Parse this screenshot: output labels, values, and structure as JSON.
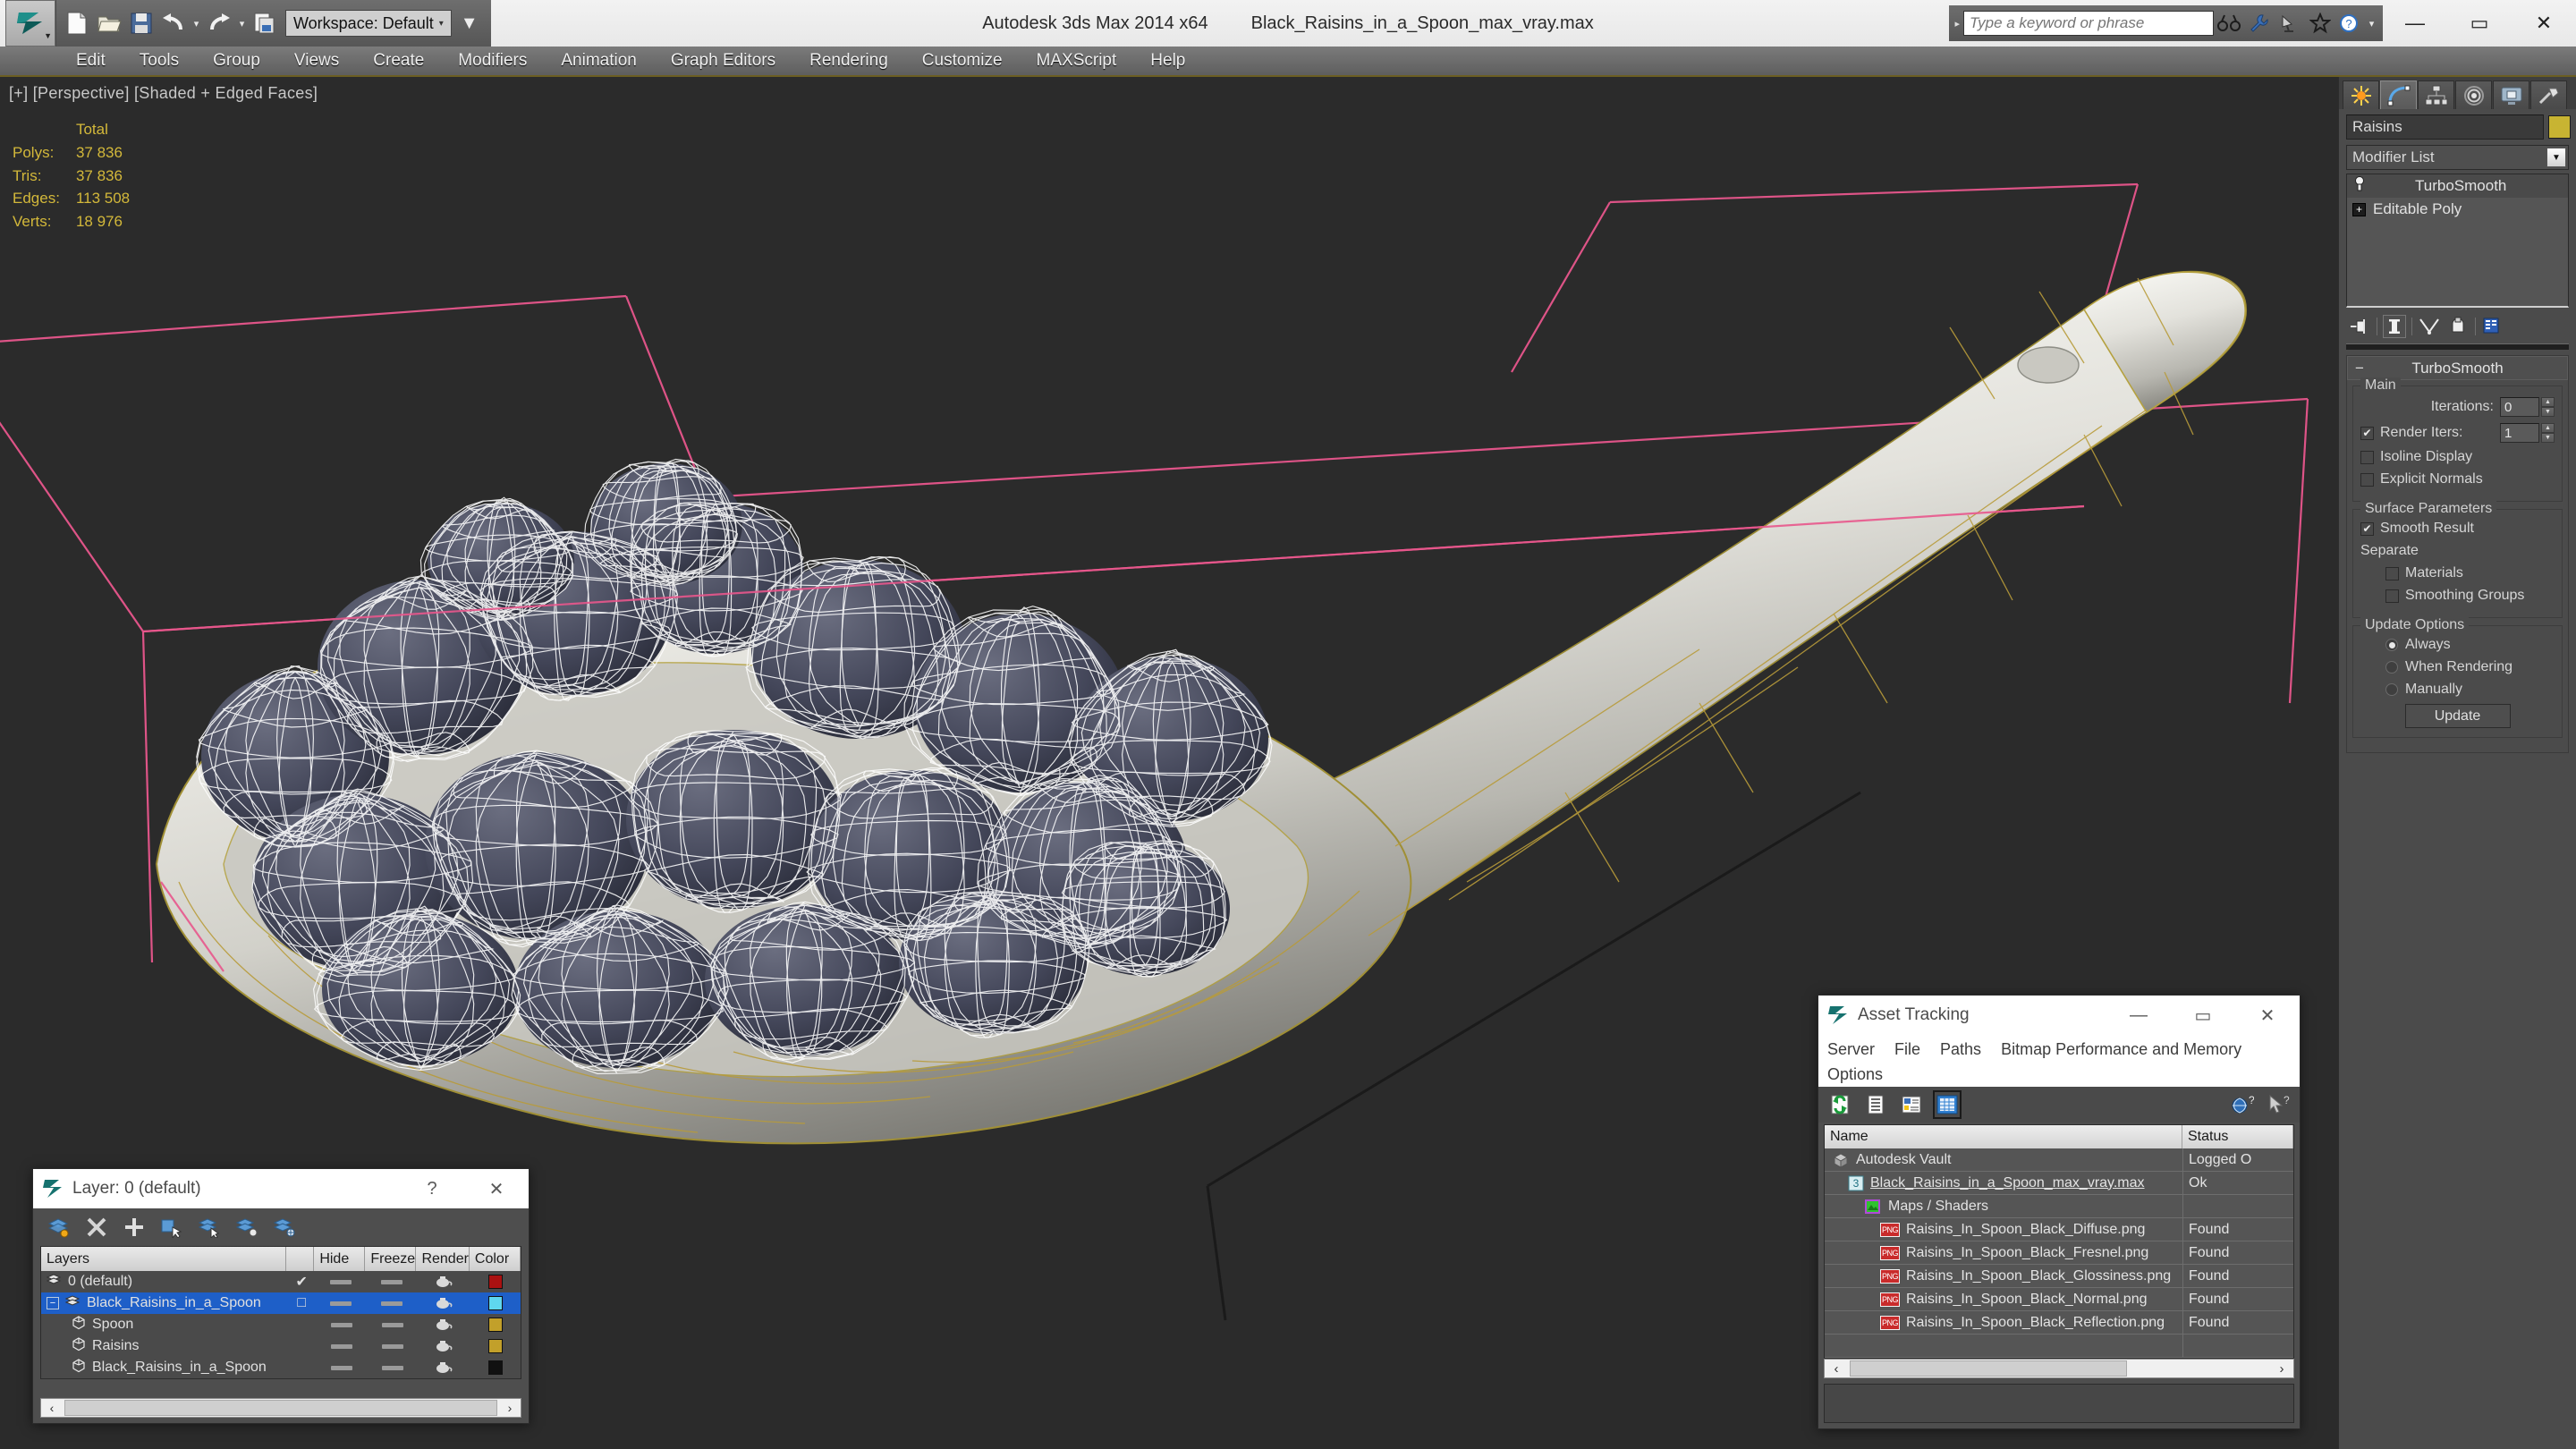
{
  "app": {
    "title": "Autodesk 3ds Max  2014 x64",
    "document": "Black_Raisins_in_a_Spoon_max_vray.max",
    "workspace_label": "Workspace: Default"
  },
  "quick_access": {
    "buttons": [
      "new-file-icon",
      "open-file-icon",
      "save-file-icon",
      "undo-icon",
      "redo-icon",
      "project-folder-icon"
    ]
  },
  "search": {
    "placeholder": "Type a keyword or phrase",
    "icons": [
      "binoculars-icon",
      "wrench-icon",
      "satellite-dish-icon",
      "star-icon",
      "help-icon"
    ]
  },
  "window_controls": {
    "minimize": "—",
    "maximize": "▭",
    "close": "✕"
  },
  "menubar": {
    "items": [
      "Edit",
      "Tools",
      "Group",
      "Views",
      "Create",
      "Modifiers",
      "Animation",
      "Graph Editors",
      "Rendering",
      "Customize",
      "MAXScript",
      "Help"
    ]
  },
  "viewport": {
    "label": "[+] [Perspective] [Shaded + Edged Faces]",
    "stats": {
      "header": "Total",
      "rows": [
        {
          "label": "Polys:",
          "value": "37 836"
        },
        {
          "label": "Tris:",
          "value": "37 836"
        },
        {
          "label": "Edges:",
          "value": "113 508"
        },
        {
          "label": "Verts:",
          "value": "18 976"
        }
      ]
    },
    "colors": {
      "background": "#2b2b2b",
      "wireframe": "#ffffff",
      "gizmo_pink": "#e8568c",
      "spoon_wire": "#b89b3a",
      "raisin_body": "#4a4d5c"
    }
  },
  "command_panel": {
    "tabs": [
      "create-tab-icon",
      "modify-tab-icon",
      "hierarchy-tab-icon",
      "motion-tab-icon",
      "display-tab-icon",
      "utilities-tab-icon"
    ],
    "active_tab_index": 1,
    "object_name": "Raisins",
    "object_color": "#c8b432",
    "modifier_list_label": "Modifier List",
    "modifier_stack": [
      {
        "label": "TurboSmooth",
        "selected": true
      },
      {
        "label": "Editable Poly",
        "selected": false
      }
    ],
    "stack_tools": [
      "pin-stack-icon",
      "show-end-result-icon",
      "make-unique-icon",
      "remove-modifier-icon",
      "configure-modifier-sets-icon"
    ],
    "rollout": {
      "title": "TurboSmooth",
      "groups": [
        {
          "label": "Main",
          "fields": [
            {
              "type": "spinner",
              "label": "Iterations:",
              "value": "0"
            },
            {
              "type": "check-spinner",
              "label": "Render Iters:",
              "value": "1",
              "checked": true
            },
            {
              "type": "checkbox",
              "label": "Isoline Display",
              "checked": false
            },
            {
              "type": "checkbox",
              "label": "Explicit Normals",
              "checked": false
            }
          ]
        },
        {
          "label": "Surface Parameters",
          "fields": [
            {
              "type": "checkbox",
              "label": "Smooth Result",
              "checked": true
            },
            {
              "type": "text",
              "label": "Separate"
            },
            {
              "type": "checkbox",
              "label": "Materials",
              "checked": false,
              "indent": true
            },
            {
              "type": "checkbox",
              "label": "Smoothing Groups",
              "checked": false,
              "indent": true
            }
          ]
        },
        {
          "label": "Update Options",
          "fields": [
            {
              "type": "radio",
              "label": "Always",
              "checked": true
            },
            {
              "type": "radio",
              "label": "When Rendering",
              "checked": false
            },
            {
              "type": "radio",
              "label": "Manually",
              "checked": false
            },
            {
              "type": "button",
              "label": "Update"
            }
          ]
        }
      ]
    }
  },
  "layer_dialog": {
    "title": "Layer: 0 (default)",
    "help_label": "?",
    "close_label": "✕",
    "toolbar": [
      "create-new-layer-icon",
      "delete-layer-icon",
      "add-selection-icon",
      "select-objects-icon",
      "select-highlighted-icon",
      "highlight-selected-icon",
      "layer-properties-icon"
    ],
    "columns": [
      "Layers",
      "",
      "Hide",
      "Freeze",
      "Render",
      "Color"
    ],
    "rows": [
      {
        "name": "0 (default)",
        "icon": "layer-icon",
        "indent": 0,
        "current": true,
        "check": "✔",
        "color": "#aa1111",
        "selected": false,
        "expander": ""
      },
      {
        "name": "Black_Raisins_in_a_Spoon",
        "icon": "layer-icon",
        "indent": 0,
        "current": false,
        "check": "□",
        "color": "#5fd7ef",
        "selected": true,
        "expander": "−"
      },
      {
        "name": "Spoon",
        "icon": "object-icon",
        "indent": 1,
        "current": false,
        "check": "",
        "color": "#c2a02a",
        "selected": false,
        "expander": ""
      },
      {
        "name": "Raisins",
        "icon": "object-icon",
        "indent": 1,
        "current": false,
        "check": "",
        "color": "#c2a02a",
        "selected": false,
        "expander": ""
      },
      {
        "name": "Black_Raisins_in_a_Spoon",
        "icon": "object-icon",
        "indent": 1,
        "current": false,
        "check": "",
        "color": "#111111",
        "selected": false,
        "expander": ""
      }
    ]
  },
  "asset_tracking": {
    "title": "Asset Tracking",
    "window_controls": {
      "minimize": "—",
      "maximize": "▭",
      "close": "✕"
    },
    "menus_row1": [
      "Server",
      "File",
      "Paths",
      "Bitmap Performance and Memory"
    ],
    "menus_row2": [
      "Options"
    ],
    "toolbar": [
      "refresh-icon",
      "list-view-icon",
      "details-view-icon",
      "grid-view-icon"
    ],
    "toolbar_right": [
      "help-globe-icon",
      "context-help-icon"
    ],
    "columns": [
      "Name",
      "Status"
    ],
    "rows": [
      {
        "name": "Autodesk Vault",
        "status": "Logged O",
        "indent": 0,
        "icon": "vault-icon"
      },
      {
        "name": "Black_Raisins_in_a_Spoon_max_vray.max",
        "status": "Ok",
        "indent": 1,
        "icon": "max-file-icon"
      },
      {
        "name": "Maps / Shaders",
        "status": "",
        "indent": 2,
        "icon": "maps-shaders-icon"
      },
      {
        "name": "Raisins_In_Spoon_Black_Diffuse.png",
        "status": "Found",
        "indent": 3,
        "icon": "png-icon"
      },
      {
        "name": "Raisins_In_Spoon_Black_Fresnel.png",
        "status": "Found",
        "indent": 3,
        "icon": "png-icon"
      },
      {
        "name": "Raisins_In_Spoon_Black_Glossiness.png",
        "status": "Found",
        "indent": 3,
        "icon": "png-icon"
      },
      {
        "name": "Raisins_In_Spoon_Black_Normal.png",
        "status": "Found",
        "indent": 3,
        "icon": "png-icon"
      },
      {
        "name": "Raisins_In_Spoon_Black_Reflection.png",
        "status": "Found",
        "indent": 3,
        "icon": "png-icon"
      }
    ],
    "scroll_arrows": {
      "left": "‹",
      "right": "›"
    }
  }
}
